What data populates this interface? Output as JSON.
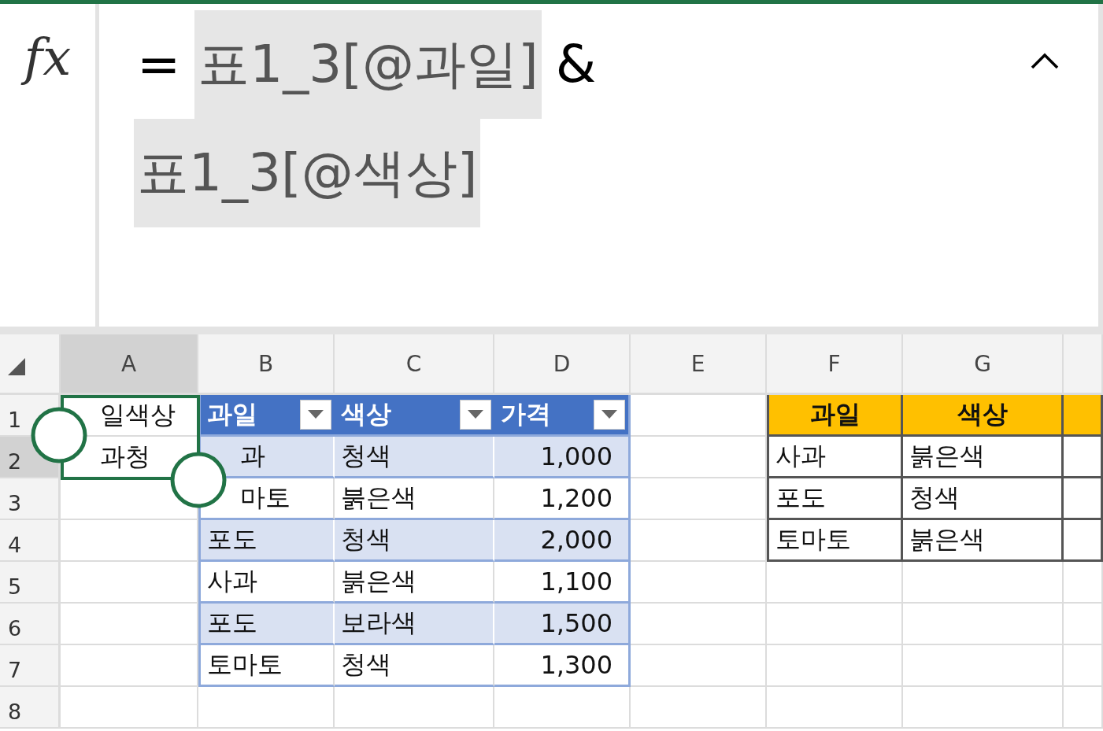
{
  "formula_bar": {
    "fx_label": "fx",
    "tokens": [
      {
        "text": "=",
        "kind": "operator"
      },
      {
        "text": "표1_3[@과일]",
        "kind": "reference"
      },
      {
        "text": "&",
        "kind": "operator"
      },
      {
        "text": "표1_3[@색상]",
        "kind": "reference"
      }
    ]
  },
  "columns": [
    {
      "label": "A",
      "selected": true
    },
    {
      "label": "B",
      "selected": false
    },
    {
      "label": "C",
      "selected": false
    },
    {
      "label": "D",
      "selected": false
    },
    {
      "label": "E",
      "selected": false
    },
    {
      "label": "F",
      "selected": false
    },
    {
      "label": "G",
      "selected": false
    }
  ],
  "rows": [
    {
      "number": "1",
      "selected": false,
      "cells": [
        {
          "kind": "plain",
          "text": "일색상",
          "selected": true
        },
        {
          "kind": "table-header",
          "text": "과일",
          "filter": true
        },
        {
          "kind": "table-header",
          "text": "색상",
          "filter": true
        },
        {
          "kind": "table-header",
          "text": "가격",
          "filter": true
        },
        {
          "kind": "plain"
        },
        {
          "kind": "list-header",
          "text": "과일"
        },
        {
          "kind": "list-header",
          "text": "색상"
        },
        {
          "kind": "list-header"
        }
      ]
    },
    {
      "number": "2",
      "selected": true,
      "cells": [
        {
          "kind": "plain",
          "text": "과청",
          "selected": true
        },
        {
          "kind": "table-band",
          "text": "과"
        },
        {
          "kind": "table-band",
          "text": "청색"
        },
        {
          "kind": "table-band",
          "text": "1,000",
          "number": true
        },
        {
          "kind": "plain"
        },
        {
          "kind": "list-cell",
          "text": "사과"
        },
        {
          "kind": "list-cell",
          "text": "붉은색"
        },
        {
          "kind": "list-cell"
        }
      ]
    },
    {
      "number": "3",
      "selected": false,
      "cells": [
        {
          "kind": "plain"
        },
        {
          "kind": "table-row",
          "text": "마토"
        },
        {
          "kind": "table-row",
          "text": "붉은색"
        },
        {
          "kind": "table-row",
          "text": "1,200",
          "number": true
        },
        {
          "kind": "plain"
        },
        {
          "kind": "list-cell",
          "text": "포도"
        },
        {
          "kind": "list-cell",
          "text": "청색"
        },
        {
          "kind": "list-cell"
        }
      ]
    },
    {
      "number": "4",
      "selected": false,
      "cells": [
        {
          "kind": "plain"
        },
        {
          "kind": "table-band",
          "text": "포도"
        },
        {
          "kind": "table-band",
          "text": "청색"
        },
        {
          "kind": "table-band",
          "text": "2,000",
          "number": true
        },
        {
          "kind": "plain"
        },
        {
          "kind": "list-cell",
          "text": "토마토"
        },
        {
          "kind": "list-cell",
          "text": "붉은색"
        },
        {
          "kind": "list-cell"
        }
      ]
    },
    {
      "number": "5",
      "selected": false,
      "cells": [
        {
          "kind": "plain"
        },
        {
          "kind": "table-row",
          "text": "사과"
        },
        {
          "kind": "table-row",
          "text": "붉은색"
        },
        {
          "kind": "table-row",
          "text": "1,100",
          "number": true
        },
        {
          "kind": "plain"
        },
        {
          "kind": "plain"
        },
        {
          "kind": "plain"
        },
        {
          "kind": "plain"
        }
      ]
    },
    {
      "number": "6",
      "selected": false,
      "cells": [
        {
          "kind": "plain"
        },
        {
          "kind": "table-band",
          "text": "포도"
        },
        {
          "kind": "table-band",
          "text": "보라색"
        },
        {
          "kind": "table-band",
          "text": "1,500",
          "number": true
        },
        {
          "kind": "plain"
        },
        {
          "kind": "plain"
        },
        {
          "kind": "plain"
        },
        {
          "kind": "plain"
        }
      ]
    },
    {
      "number": "7",
      "selected": false,
      "cells": [
        {
          "kind": "plain"
        },
        {
          "kind": "table-row",
          "text": "토마토"
        },
        {
          "kind": "table-row",
          "text": "청색"
        },
        {
          "kind": "table-row",
          "text": "1,300",
          "number": true
        },
        {
          "kind": "plain"
        },
        {
          "kind": "plain"
        },
        {
          "kind": "plain"
        },
        {
          "kind": "plain"
        }
      ]
    },
    {
      "number": "8",
      "selected": false,
      "cells": [
        {
          "kind": "plain"
        },
        {
          "kind": "plain"
        },
        {
          "kind": "plain"
        },
        {
          "kind": "plain"
        },
        {
          "kind": "plain"
        },
        {
          "kind": "plain"
        },
        {
          "kind": "plain"
        },
        {
          "kind": "plain"
        }
      ]
    }
  ]
}
